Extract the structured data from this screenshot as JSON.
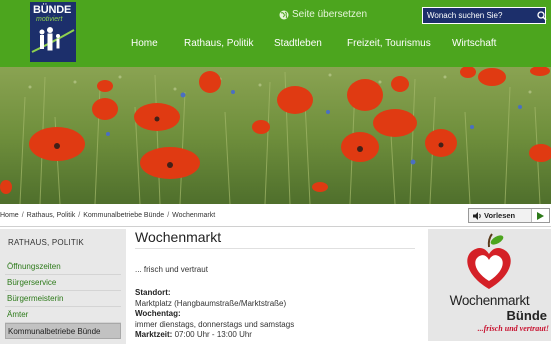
{
  "header": {
    "logo_title": "BÜNDE",
    "logo_sub": "motiviert",
    "translate_label": "Seite übersetzen",
    "search_placeholder": "Wonach suchen Sie?",
    "nav": [
      {
        "label": "Home"
      },
      {
        "label": "Rathaus, Politik"
      },
      {
        "label": "Stadtleben"
      },
      {
        "label": "Freizeit, Tourismus"
      },
      {
        "label": "Wirtschaft"
      }
    ],
    "colors": {
      "header_green": "#4ca51e",
      "logo_navy": "#1c2f6b"
    }
  },
  "hero": {
    "alt": "poppy-field-image"
  },
  "breadcrumb": [
    {
      "label": "Home"
    },
    {
      "label": "Rathaus, Politik"
    },
    {
      "label": "Kommunalbetriebe Bünde"
    },
    {
      "label": "Wochenmarkt"
    }
  ],
  "readspeaker": {
    "label": "Vorlesen"
  },
  "sidebar": {
    "title": "RATHAUS, POLITIK",
    "items": [
      {
        "label": "Öffnungszeiten",
        "active": false
      },
      {
        "label": "Bürgerservice",
        "active": false
      },
      {
        "label": "Bürgermeisterin",
        "active": false
      },
      {
        "label": "Ämter",
        "active": false
      },
      {
        "label": "Kommunalbetriebe Bünde",
        "active": true
      }
    ]
  },
  "content": {
    "title": "Wochenmarkt",
    "intro": "... frisch und vertraut",
    "standort_label": "Standort:",
    "standort_value": "Marktplatz (Hangbaumstraße/Marktstraße)",
    "wochentag_label": "Wochentag:",
    "wochentag_value": "immer dienstags, donnerstags und samstags",
    "marktzeit_label": "Marktzeit:",
    "marktzeit_value": "07:00 Uhr - 13:00 Uhr"
  },
  "promo": {
    "brand": "Wochenmarkt",
    "city": "Bünde",
    "slogan": "...frisch und vertraut!",
    "colors": {
      "apple_red": "#d42027",
      "leaf_green": "#4ca51e"
    }
  }
}
